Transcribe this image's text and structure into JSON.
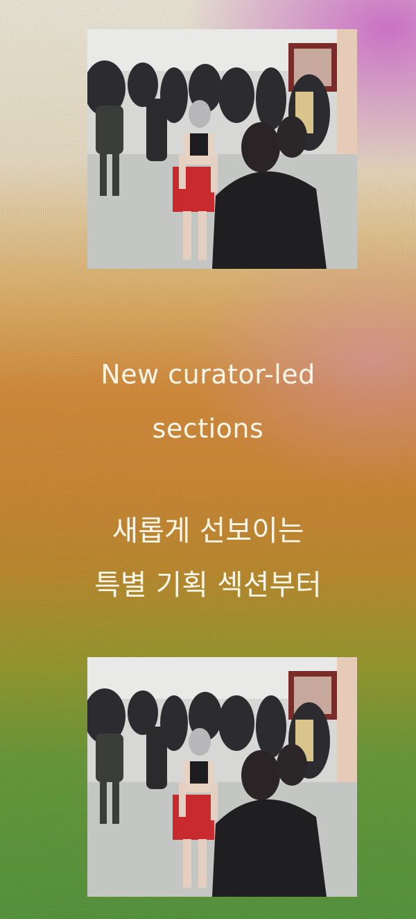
{
  "headline": {
    "line1": "New curator-led",
    "line2": "sections"
  },
  "korean": {
    "line1": "새롭게 선보이는",
    "line2": "특별 기획 섹션부터"
  },
  "photos": [
    {
      "name": "top-photo"
    },
    {
      "name": "bottom-photo"
    }
  ],
  "colors": {
    "text": "#fbf6ea",
    "gradient_top": "#e7e2d3",
    "gradient_middle": "#cf8a3c",
    "gradient_bottom": "#55933d",
    "accent_magenta": "#cd6ec8"
  }
}
